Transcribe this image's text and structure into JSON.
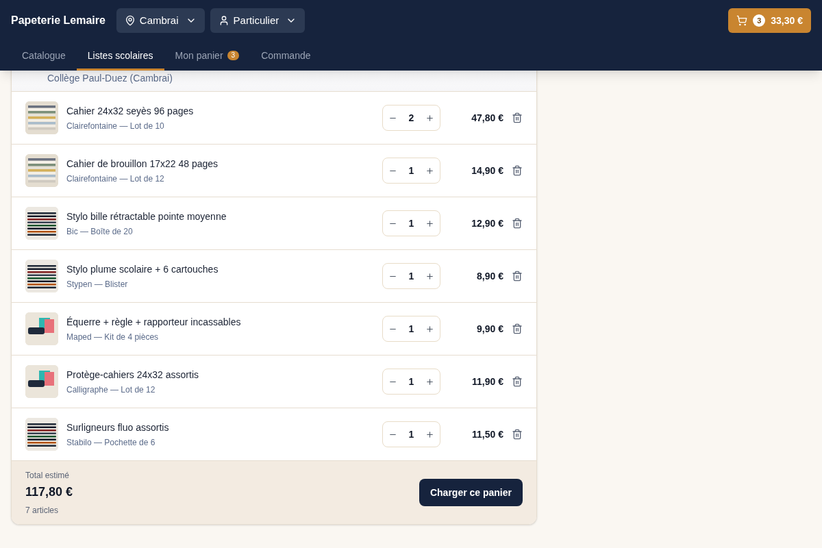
{
  "header": {
    "brand": "Papeterie Lemaire",
    "location": {
      "label": "Cambrai"
    },
    "profile": {
      "label": "Particulier"
    },
    "cart": {
      "count": "3",
      "total": "33,30 €"
    }
  },
  "nav": [
    {
      "label": "Catalogue",
      "selected": false
    },
    {
      "label": "Listes scolaires",
      "selected": true
    },
    {
      "label": "Mon panier",
      "selected": false,
      "badge": "3"
    },
    {
      "label": "Commande",
      "selected": false
    }
  ],
  "list": {
    "subtitle": "Collège Paul-Duez (Cambrai)",
    "items": [
      {
        "name": "Cahier 24x32 seyès 96 pages",
        "detail": "Clairefontaine — Lot de 10",
        "quantity": "2",
        "price": "47,80 €",
        "kind": "notebooks"
      },
      {
        "name": "Cahier de brouillon 17x22 48 pages",
        "detail": "Clairefontaine — Lot de 12",
        "quantity": "1",
        "price": "14,90 €",
        "kind": "notebooks"
      },
      {
        "name": "Stylo bille rétractable pointe moyenne",
        "detail": "Bic — Boîte de 20",
        "quantity": "1",
        "price": "12,90 €",
        "kind": "pens"
      },
      {
        "name": "Stylo plume scolaire + 6 cartouches",
        "detail": "Stypen — Blister",
        "quantity": "1",
        "price": "8,90 €",
        "kind": "pens"
      },
      {
        "name": "Équerre + règle + rapporteur incassables",
        "detail": "Maped — Kit de 4 pièces",
        "quantity": "1",
        "price": "9,90 €",
        "kind": "kit"
      },
      {
        "name": "Protège-cahiers 24x32 assortis",
        "detail": "Calligraphe — Lot de 12",
        "quantity": "1",
        "price": "11,90 €",
        "kind": "kit"
      },
      {
        "name": "Surligneurs fluo assortis",
        "detail": "Stabilo — Pochette de 6",
        "quantity": "1",
        "price": "11,50 €",
        "kind": "pens"
      }
    ],
    "footer": {
      "label": "Total estimé",
      "total": "117,80 €",
      "count": "7 articles",
      "button": "Charger ce panier"
    }
  }
}
